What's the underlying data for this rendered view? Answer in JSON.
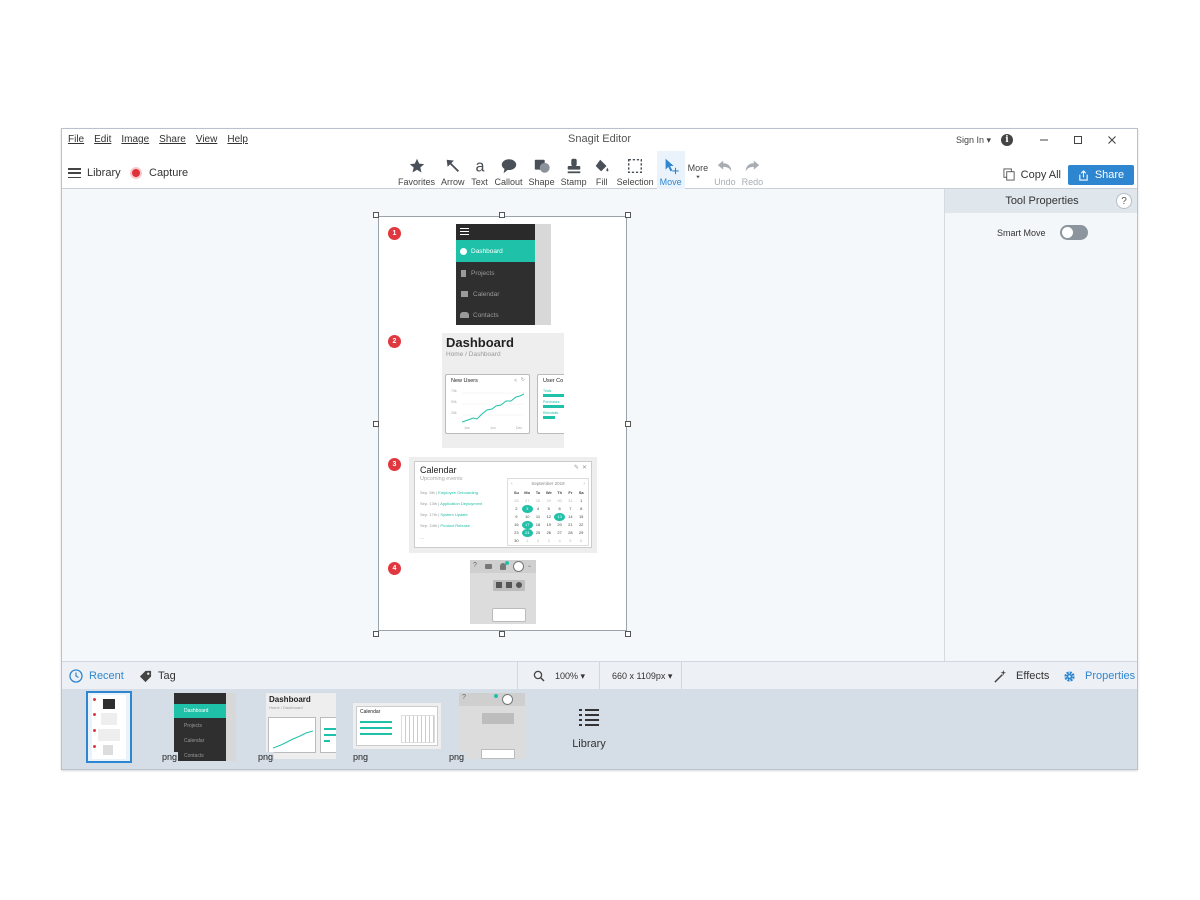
{
  "window": {
    "title": "Snagit Editor",
    "menu": [
      "File",
      "Edit",
      "Image",
      "Share",
      "View",
      "Help"
    ],
    "sign_in": "Sign In ▾",
    "info_icon": "info-icon",
    "controls": [
      "minimize",
      "maximize",
      "close"
    ]
  },
  "toolbar": {
    "library_label": "Library",
    "capture_label": "Capture",
    "tools": [
      {
        "label": "Favorites",
        "icon": "star-icon",
        "state": "normal"
      },
      {
        "label": "Arrow",
        "icon": "arrow-icon",
        "state": "normal"
      },
      {
        "label": "Text",
        "icon": "text-icon",
        "state": "normal"
      },
      {
        "label": "Callout",
        "icon": "callout-icon",
        "state": "normal"
      },
      {
        "label": "Shape",
        "icon": "shape-icon",
        "state": "normal"
      },
      {
        "label": "Stamp",
        "icon": "stamp-icon",
        "state": "normal"
      },
      {
        "label": "Fill",
        "icon": "fill-icon",
        "state": "normal"
      },
      {
        "label": "Selection",
        "icon": "selection-icon",
        "state": "normal"
      },
      {
        "label": "Move",
        "icon": "move-icon",
        "state": "active"
      },
      {
        "label": "More",
        "icon": "more-dropdown-icon",
        "state": "normal"
      },
      {
        "label": "Undo",
        "icon": "undo-icon",
        "state": "disabled"
      },
      {
        "label": "Redo",
        "icon": "redo-icon",
        "state": "disabled"
      }
    ],
    "copy_all_label": "Copy All",
    "share_label": "Share"
  },
  "canvas": {
    "steps": [
      "1",
      "2",
      "3",
      "4"
    ],
    "sidebar_menu": [
      "Dashboard",
      "Projects",
      "Calendar",
      "Contacts"
    ],
    "dashboard": {
      "title": "Dashboard",
      "breadcrumb": "Home / Dashboard",
      "card_new_users": "New Users",
      "card_user": "User Co",
      "chart_y_ticks": [
        "75k",
        "50k",
        "25k"
      ],
      "chart_x_ticks": [
        "Jan",
        "Jun",
        "Dec"
      ],
      "user_rows": [
        "Trials",
        "Purchases",
        "Reinstalls"
      ]
    },
    "calendar": {
      "title": "Calendar",
      "subtitle": "Upcoming events",
      "events": [
        {
          "date": "Sep. 5th",
          "name": "Employee Onboarding"
        },
        {
          "date": "Sep. 13th",
          "name": "Application Deployment"
        },
        {
          "date": "Sep. 17th",
          "name": "System Update"
        },
        {
          "date": "Sep. 24th",
          "name": "Product Release"
        }
      ],
      "more": "...",
      "month": "September 2018",
      "weekdays": [
        "Su",
        "Mo",
        "Tu",
        "We",
        "Th",
        "Fr",
        "Sa"
      ],
      "weeks": [
        [
          "26",
          "27",
          "28",
          "29",
          "30",
          "31",
          "1"
        ],
        [
          "2",
          "3",
          "4",
          "5",
          "6",
          "7",
          "8"
        ],
        [
          "9",
          "10",
          "11",
          "12",
          "13",
          "14",
          "15"
        ],
        [
          "16",
          "17",
          "18",
          "19",
          "20",
          "21",
          "22"
        ],
        [
          "23",
          "24",
          "25",
          "26",
          "27",
          "28",
          "29"
        ],
        [
          "30",
          "1",
          "2",
          "3",
          "4",
          "5",
          "6"
        ]
      ],
      "highlighted": [
        "3",
        "13",
        "17",
        "24"
      ]
    }
  },
  "properties": {
    "title": "Tool Properties",
    "help": "?",
    "smart_move_label": "Smart Move",
    "smart_move_on": false
  },
  "status": {
    "recent": "Recent",
    "tag": "Tag",
    "zoom": "100% ▾",
    "size": "660 x 1109px ▾",
    "effects": "Effects",
    "properties": "Properties"
  },
  "tray": {
    "items": [
      {
        "label": "",
        "selected": true
      },
      {
        "label": "png"
      },
      {
        "label": "png"
      },
      {
        "label": "png"
      },
      {
        "label": "png"
      }
    ],
    "library_label": "Library",
    "thumb2_menu": [
      "Dashboard",
      "Projects",
      "Calendar",
      "Contacts"
    ],
    "thumb3_title": "Dashboard",
    "thumb3_breadcrumb": "Home / Dashboard",
    "thumb4_title": "Calendar"
  },
  "colors": {
    "accent": "#2f86d0",
    "teal": "#1fc1a8",
    "step_red": "#e0383f",
    "capture_red": "#e0303a"
  }
}
